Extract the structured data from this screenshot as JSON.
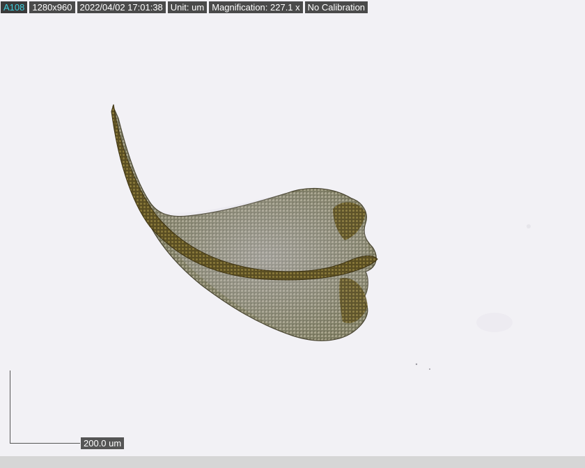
{
  "info_bar": {
    "camera_id": "A108",
    "resolution": "1280x960",
    "timestamp": "2022/04/02 17:01:38",
    "unit": "Unit: um",
    "magnification": "Magnification:  227.1 x",
    "calibration": "No Calibration"
  },
  "scale": {
    "label": "200.0 um"
  },
  "colors": {
    "background": "#f2f1f5",
    "specimen_body": "#6b6a4a",
    "midrib": "#4a3f1a",
    "accent_id": "#3fd0e0"
  }
}
